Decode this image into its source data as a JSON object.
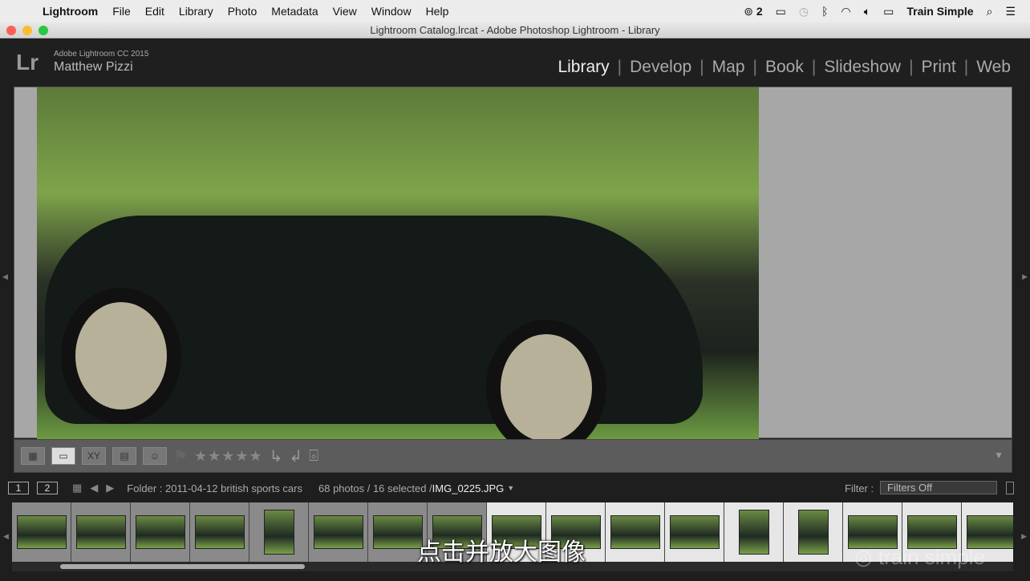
{
  "menubar": {
    "app": "Lightroom",
    "items": [
      "File",
      "Edit",
      "Library",
      "Photo",
      "Metadata",
      "View",
      "Window",
      "Help"
    ],
    "cc_count": "2",
    "user": "Train Simple"
  },
  "window": {
    "title": "Lightroom Catalog.lrcat - Adobe Photoshop Lightroom - Library"
  },
  "identity": {
    "logo": "Lr",
    "product": "Adobe Lightroom CC 2015",
    "user": "Matthew Pizzi"
  },
  "modules": [
    {
      "label": "Library",
      "active": true
    },
    {
      "label": "Develop"
    },
    {
      "label": "Map"
    },
    {
      "label": "Book"
    },
    {
      "label": "Slideshow"
    },
    {
      "label": "Print"
    },
    {
      "label": "Web"
    }
  ],
  "toolbar": {
    "compare_label": "XY",
    "rating_stars": "★★★★★"
  },
  "filmstrip_bar": {
    "page1": "1",
    "page2": "2",
    "folder": "Folder : 2011-04-12 british sports cars",
    "count": "68 photos / 16 selected /",
    "file": "IMG_0225.JPG",
    "filter_label": "Filter :",
    "filter_value": "Filters Off"
  },
  "filmstrip": {
    "thumbs": [
      {
        "selected": true
      },
      {
        "selected": true
      },
      {
        "selected": true
      },
      {
        "selected": true
      },
      {
        "selected": true,
        "tall": true
      },
      {
        "selected": true
      },
      {
        "selected": true
      },
      {
        "selected": true
      },
      {
        "selected": false
      },
      {
        "selected": false
      },
      {
        "selected": false
      },
      {
        "selected": false
      },
      {
        "selected": false,
        "tall": true
      },
      {
        "selected": false,
        "tall": true
      },
      {
        "selected": false
      },
      {
        "selected": false
      },
      {
        "selected": false
      }
    ]
  },
  "overlay": {
    "subtitle": "点击并放大图像",
    "watermark": "train simple"
  }
}
